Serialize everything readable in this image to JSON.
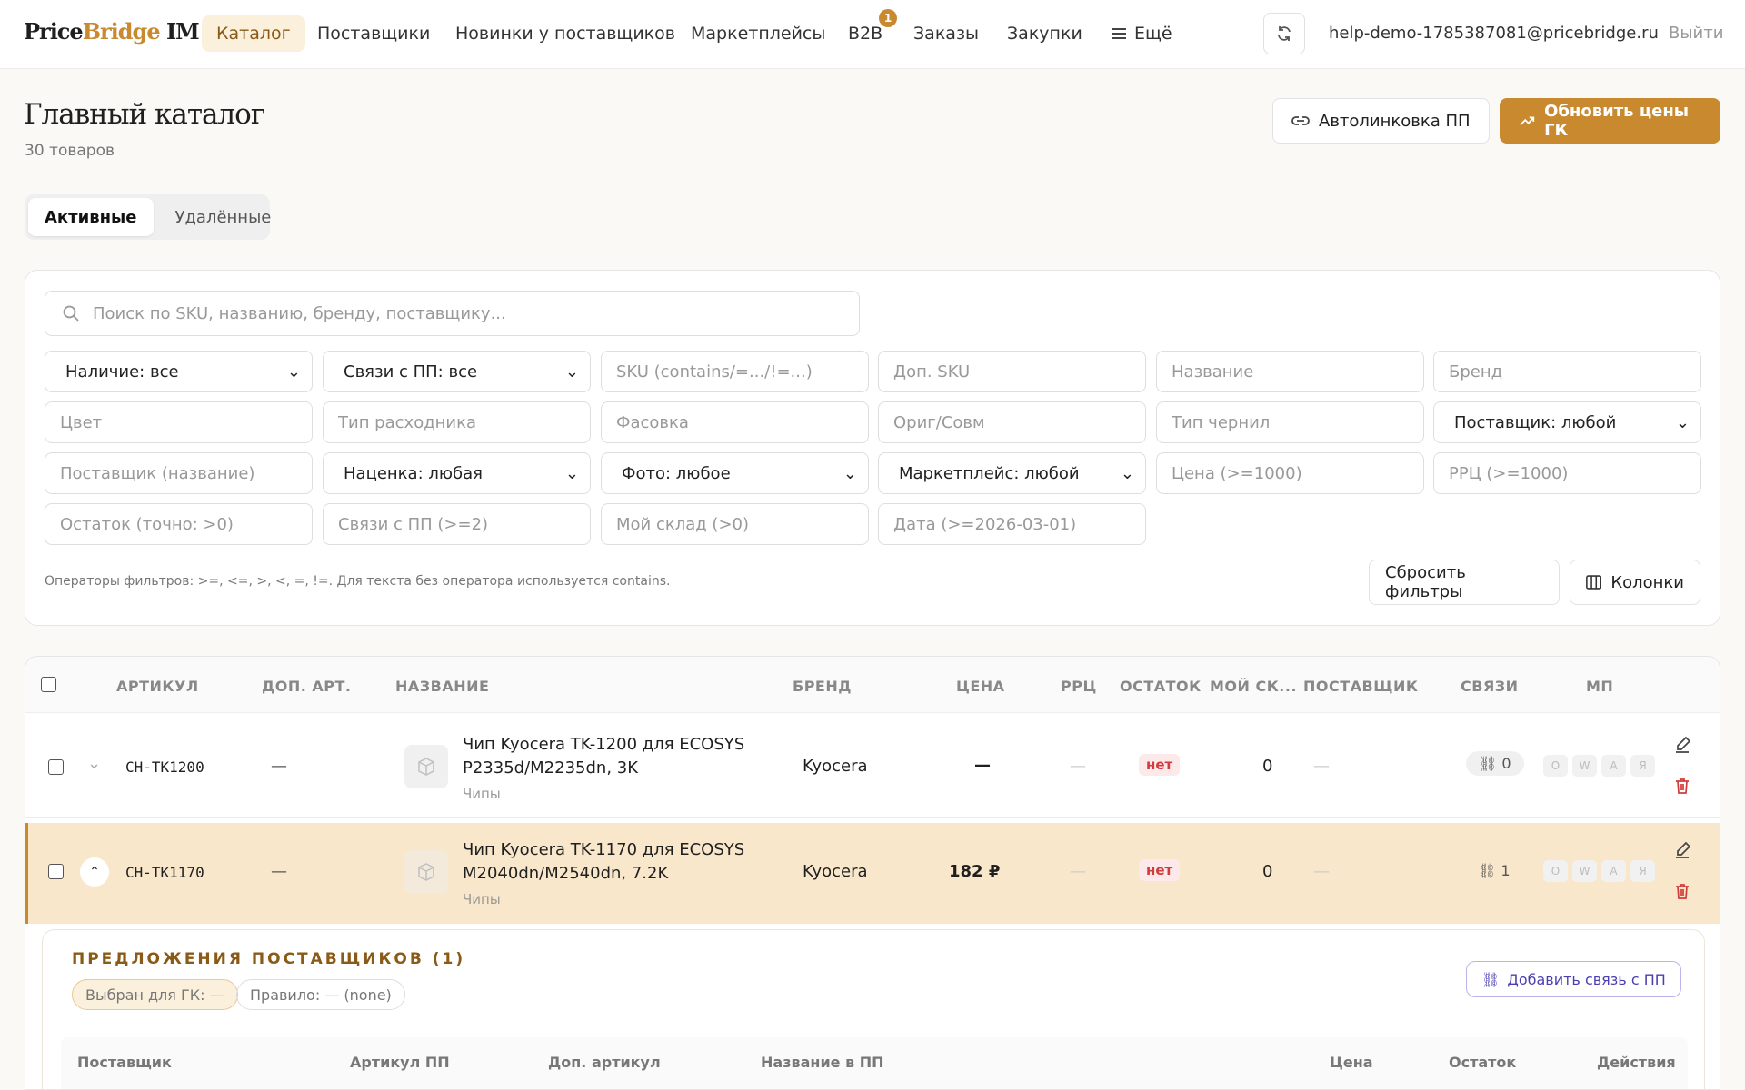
{
  "header": {
    "logo_a": "Price",
    "logo_b": "Bridge",
    "logo_c": " IM",
    "nav": [
      "Каталог",
      "Поставщики",
      "Новинки у поставщиков",
      "Маркетплейсы",
      "B2B",
      "Заказы",
      "Закупки",
      "Ещё"
    ],
    "b2b_badge": "1",
    "email": "help-demo-1785387081@pricebridge.ru",
    "logout": "Выйти"
  },
  "page": {
    "title": "Главный каталог",
    "subtitle": "30 товаров",
    "autolink_label": "Автолинковка ПП",
    "update_label": "Обновить цены ГК",
    "tab_active": "Активные",
    "tab_deleted": "Удалённые"
  },
  "filters": {
    "search_placeholder": "Поиск по SKU, названию, бренду, поставщику...",
    "availability": "Наличие: все",
    "links_select": "Связи с ПП: все",
    "sku": "SKU (contains/=.../!=...)",
    "extra_sku": "Доп. SKU",
    "name": "Название",
    "brand": "Бренд",
    "color": "Цвет",
    "consumable_type": "Тип расходника",
    "packaging": "Фасовка",
    "orig_compat": "Ориг/Совм",
    "ink_type": "Тип чернил",
    "supplier_select": "Поставщик: любой",
    "supplier_name": "Поставщик (название)",
    "markup": "Наценка: любая",
    "photo": "Фото: любое",
    "marketplace": "Маркетплейс: любой",
    "price": "Цена (>=1000)",
    "rrp": "РРЦ (>=1000)",
    "stock": "Остаток (точно: >0)",
    "links_count": "Связи с ПП (>=2)",
    "my_stock": "Мой склад (>0)",
    "date": "Дата (>=2026-03-01)",
    "hint": "Операторы фильтров: >=, <=, >, <, =, !=. Для текста без оператора используется contains.",
    "reset": "Сбросить фильтры",
    "columns": "Колонки"
  },
  "table": {
    "headers": [
      "АРТИКУЛ",
      "ДОП. АРТ.",
      "НАЗВАНИЕ",
      "БРЕНД",
      "ЦЕНА",
      "РРЦ",
      "ОСТАТОК",
      "МОЙ СК...",
      "ПОСТАВЩИК",
      "СВЯЗИ",
      "МП"
    ],
    "rows": [
      {
        "sku": "CH-TK1200",
        "extra": "—",
        "name1": "Чип Kyocera TK-1200 для ECOSYS",
        "name2": "P2335d/M2235dn, 3K",
        "cat": "Чипы",
        "brand": "Kyocera",
        "price": "—",
        "rrp": "—",
        "stock": "нет",
        "my": "0",
        "supplier": "—",
        "links": "0"
      },
      {
        "sku": "CH-TK1170",
        "extra": "—",
        "name1": "Чип Kyocera TK-1170 для ECOSYS",
        "name2": "M2040dn/M2540dn, 7.2K",
        "cat": "Чипы",
        "brand": "Kyocera",
        "price": "182 ₽",
        "rrp": "—",
        "stock": "нет",
        "my": "0",
        "supplier": "—",
        "links": "1"
      }
    ],
    "mp": [
      "O",
      "W",
      "A",
      "Я"
    ]
  },
  "offers": {
    "title": "ПРЕДЛОЖЕНИЯ ПОСТАВЩИКОВ (1)",
    "chosen": "Выбран для ГК: —",
    "rule": "Правило: — (none)",
    "add_link": "Добавить связь с ПП",
    "headers": [
      "Поставщик",
      "Артикул ПП",
      "Доп. артикул",
      "Название в ПП",
      "Цена",
      "Остаток",
      "Действия"
    ]
  },
  "colors": {
    "accent": "#c8892f",
    "highlight": "#f9e7cb",
    "danger": "#d23b3b"
  }
}
